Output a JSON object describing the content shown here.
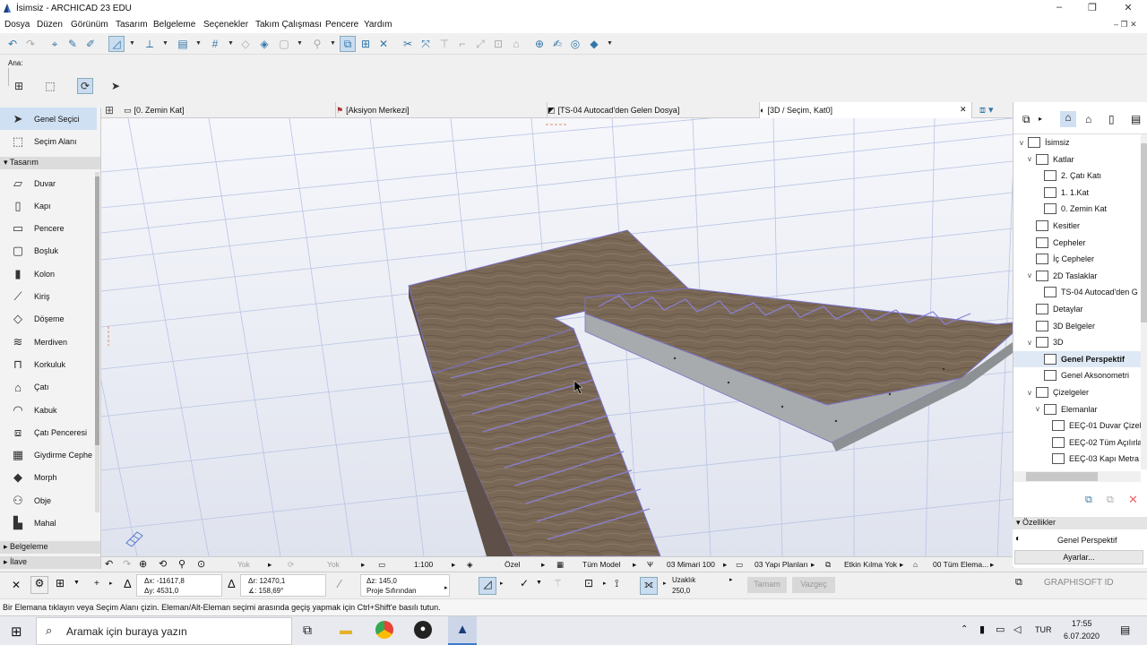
{
  "window": {
    "title": "İsimsiz - ARCHICAD 23 EDU",
    "minimize_label": "–",
    "maximize_label": "❐",
    "close_label": "✕"
  },
  "menu": [
    "Dosya",
    "Düzen",
    "Görünüm",
    "Tasarım",
    "Belgeleme",
    "Seçenekler",
    "Takım Çalışması",
    "Pencere",
    "Yardım"
  ],
  "ana_label": "Ana:",
  "tabs": [
    {
      "label": "[0. Zemin Kat]"
    },
    {
      "label": "[Aksiyon Merkezi]"
    },
    {
      "label": "[TS-04 Autocad'den Gelen Dosya]"
    },
    {
      "label": "[3D / Seçim, Kat0]",
      "close": "✕"
    }
  ],
  "toolbox": {
    "top_items": [
      {
        "label": "Genel Seçici",
        "icon": "arrow-icon"
      },
      {
        "label": "Seçim Alanı",
        "icon": "marquee-icon"
      }
    ],
    "group_tasarim": "Tasarım",
    "items": [
      {
        "label": "Duvar",
        "icon": "wall-icon"
      },
      {
        "label": "Kapı",
        "icon": "door-icon"
      },
      {
        "label": "Pencere",
        "icon": "window-icon"
      },
      {
        "label": "Boşluk",
        "icon": "opening-icon"
      },
      {
        "label": "Kolon",
        "icon": "column-icon"
      },
      {
        "label": "Kiriş",
        "icon": "beam-icon"
      },
      {
        "label": "Döşeme",
        "icon": "slab-icon"
      },
      {
        "label": "Merdiven",
        "icon": "stair-icon"
      },
      {
        "label": "Korkuluk",
        "icon": "railing-icon"
      },
      {
        "label": "Çatı",
        "icon": "roof-icon"
      },
      {
        "label": "Kabuk",
        "icon": "shell-icon"
      },
      {
        "label": "Çatı Penceresi",
        "icon": "skylight-icon"
      },
      {
        "label": "Giydirme Cephe",
        "icon": "curtain-wall-icon"
      },
      {
        "label": "Morph",
        "icon": "morph-icon"
      },
      {
        "label": "Obje",
        "icon": "object-icon"
      },
      {
        "label": "Mahal",
        "icon": "zone-icon"
      }
    ],
    "group_belgeleme": "Belgeleme",
    "group_ilave": "İlave"
  },
  "navigator": {
    "tree": [
      {
        "label": "İsimsiz",
        "level": 0,
        "expand": "v"
      },
      {
        "label": "Katlar",
        "level": 1,
        "expand": "v"
      },
      {
        "label": "2. Çatı Katı",
        "level": 2,
        "expand": ""
      },
      {
        "label": "1. 1.Kat",
        "level": 2,
        "expand": ""
      },
      {
        "label": "0. Zemin Kat",
        "level": 2,
        "expand": ""
      },
      {
        "label": "Kesitler",
        "level": 1,
        "expand": ""
      },
      {
        "label": "Cepheler",
        "level": 1,
        "expand": ""
      },
      {
        "label": "İç Cepheler",
        "level": 1,
        "expand": ""
      },
      {
        "label": "2D Taslaklar",
        "level": 1,
        "expand": "v"
      },
      {
        "label": "TS-04 Autocad'den G",
        "level": 2,
        "expand": ""
      },
      {
        "label": "Detaylar",
        "level": 1,
        "expand": ""
      },
      {
        "label": "3D Belgeler",
        "level": 1,
        "expand": ""
      },
      {
        "label": "3D",
        "level": 1,
        "expand": "v"
      },
      {
        "label": "Genel Perspektif",
        "level": 2,
        "expand": "",
        "selected": true
      },
      {
        "label": "Genel Aksonometri",
        "level": 2,
        "expand": ""
      },
      {
        "label": "Çizelgeler",
        "level": 1,
        "expand": "v"
      },
      {
        "label": "Elemanlar",
        "level": 2,
        "expand": "v"
      },
      {
        "label": "EEÇ-01 Duvar Çizel",
        "level": 3,
        "expand": ""
      },
      {
        "label": "EEÇ-02 Tüm Açılırla",
        "level": 3,
        "expand": ""
      },
      {
        "label": "EEÇ-03 Kapı Metra",
        "level": 3,
        "expand": ""
      }
    ],
    "properties_header": "Özellikler",
    "properties_value": "Genel Perspektif",
    "settings_button": "Ayarlar..."
  },
  "quick_options": {
    "yok1": "Yok",
    "yok2": "Yok",
    "scale": "1:100",
    "ozel": "Özel",
    "model": "Tüm Model",
    "pen": "03 Mimari 100",
    "plan": "03 Yapı Planları",
    "renovation": "Etkin Kılma Yok",
    "elements": "00 Tüm Elema..."
  },
  "info_box": {
    "dx": "Δx: -11617,8",
    "dy": "Δy: 4531,0",
    "dr": "Δr: 12470,1",
    "da": "∡: 158,69°",
    "dz": "Δz: 145,0",
    "proj_zero": "Proje Sıfırından",
    "distance_label": "Uzaklık",
    "distance_value": "250,0",
    "ok": "Tamam",
    "cancel": "Vazgeç"
  },
  "graphisoft_id": "GRAPHISOFT ID",
  "status_message": "Bir Elemana tıklayın veya Seçim Alanı çizin. Eleman/Alt-Eleman seçimi arasında geçiş yapmak için Ctrl+Shift'e basılı tutun.",
  "taskbar": {
    "search_placeholder": "Aramak için buraya yazın",
    "lang": "TUR",
    "time": "17:55",
    "date": "6.07.2020"
  },
  "colors": {
    "accent": "#3c78c8",
    "wood": "#7a6856",
    "concrete": "#a8abad",
    "grid": "#9fb0dc"
  }
}
